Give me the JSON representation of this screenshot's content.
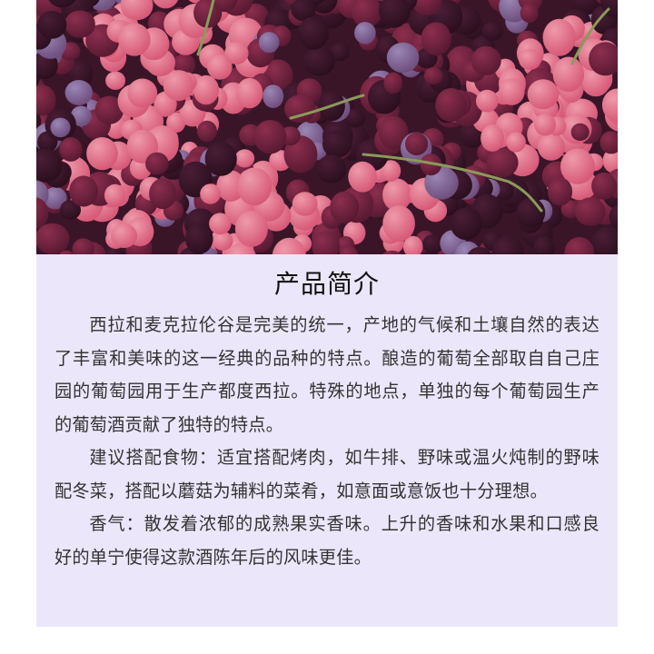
{
  "image": {
    "subject": "red-grape-bunches-photo",
    "colors": {
      "dark": "#4a1e36",
      "mid": "#8c2f4e",
      "bright": "#d75a78",
      "highlight": "#ee9aab",
      "purple": "#6f4f7e",
      "stem": "#8a9a5a"
    }
  },
  "intro": {
    "title": "产品简介",
    "paragraphs": [
      "西拉和麦克拉伦谷是完美的统一，产地的气候和土壤自然的表达了丰富和美味的这一经典的品种的特点。酿造的葡萄全部取自自己庄园的葡萄园用于生产都度西拉。特殊的地点，单独的每个葡萄园生产的葡萄酒贡献了独特的特点。",
      "建议搭配食物：适宜搭配烤肉，如牛排、野味或温火炖制的野味配冬菜，搭配以蘑菇为辅料的菜肴，如意面或意饭也十分理想。",
      "香气：散发着浓郁的成熟果实香味。上升的香味和水果和口感良好的单宁使得这款酒陈年后的风味更佳。"
    ]
  },
  "colors": {
    "panel_bg": "#ece6fa",
    "title_text": "#111111",
    "body_text": "#333333"
  }
}
